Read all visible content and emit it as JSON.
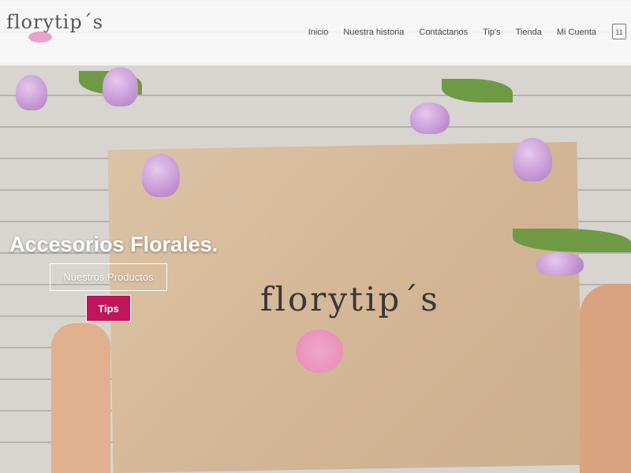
{
  "header": {
    "logo": "florytip´s",
    "nav": [
      "Inicio",
      "Nuestra historia",
      "Contáctanos",
      "Tip's",
      "Tienda",
      "Mi Cuenta"
    ],
    "cart_count": "11",
    "cart_icon": "shopping-bag-icon"
  },
  "hero": {
    "title": "Accesorios Florales.",
    "primary_button": "Nuestros Productos",
    "secondary_button": "Tips",
    "center_logo": "florytip´s",
    "accent_color": "#c0155a"
  }
}
